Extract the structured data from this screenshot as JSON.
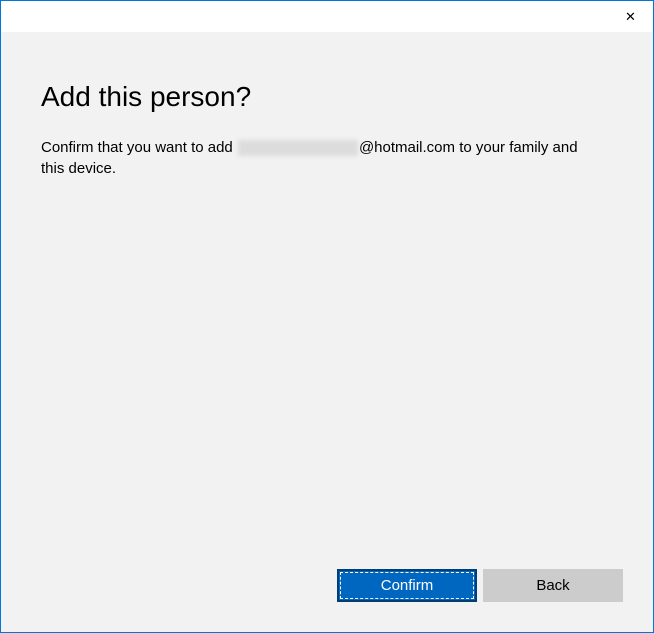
{
  "dialog": {
    "heading": "Add this person?",
    "body_prefix": "Confirm that you want to add ",
    "email_suffix": "@hotmail.com to your family and this device."
  },
  "buttons": {
    "confirm": "Confirm",
    "back": "Back"
  },
  "titlebar": {
    "close_glyph": "✕"
  }
}
